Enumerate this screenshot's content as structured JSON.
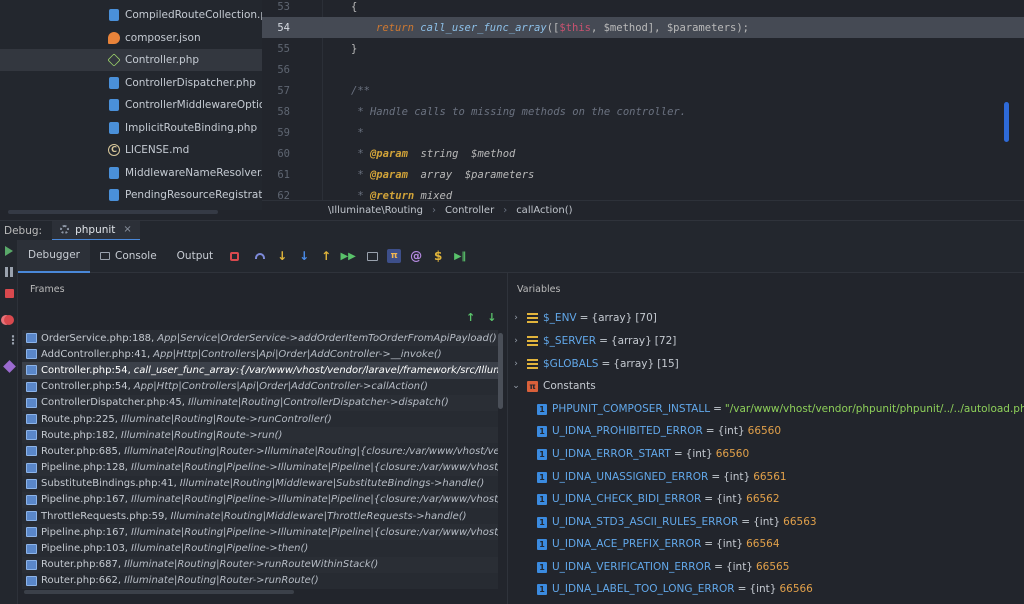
{
  "project_tree": {
    "items": [
      {
        "label": "CompiledRouteCollection.php",
        "icon": "php-file-icon"
      },
      {
        "label": "composer.json",
        "icon": "json-file-icon"
      },
      {
        "label": "Controller.php",
        "icon": "class-icon",
        "selected": true
      },
      {
        "label": "ControllerDispatcher.php",
        "icon": "php-file-icon"
      },
      {
        "label": "ControllerMiddlewareOptions",
        "icon": "php-file-icon"
      },
      {
        "label": "ImplicitRouteBinding.php",
        "icon": "php-file-icon"
      },
      {
        "label": "LICENSE.md",
        "icon": "license-icon"
      },
      {
        "label": "MiddlewareNameResolver.ph",
        "icon": "php-file-icon"
      },
      {
        "label": "PendingResourceRegistration",
        "icon": "php-file-icon"
      }
    ]
  },
  "editor": {
    "lines": [
      {
        "num": "53",
        "text": "{"
      },
      {
        "num": "54",
        "kw": "return ",
        "fn": "call_user_func_array",
        "open": "([",
        "this": "$this",
        "rest": ", $method], $parameters);"
      },
      {
        "num": "55",
        "text": "}"
      },
      {
        "num": "56",
        "text": ""
      },
      {
        "num": "57",
        "comment": "/**"
      },
      {
        "num": "58",
        "comment": " * Handle calls to missing methods on the controller."
      },
      {
        "num": "59",
        "comment": " *"
      },
      {
        "num": "60",
        "star": " * ",
        "tag": "@param",
        "type": "  string",
        "var": "  $method"
      },
      {
        "num": "61",
        "star": " * ",
        "tag": "@param",
        "type": "  array",
        "var": "  $parameters"
      },
      {
        "num": "62",
        "star": " * ",
        "tag": "@return",
        "type": " mixed",
        "var": ""
      }
    ],
    "breadcrumb": [
      "\\Illuminate\\Routing",
      "Controller",
      "callAction()"
    ]
  },
  "debug_bar": {
    "label": "Debug:",
    "tab": "phpunit",
    "close": "×"
  },
  "tabs": {
    "debugger": "Debugger",
    "console": "Console",
    "output": "Output"
  },
  "frames": {
    "title": "Frames",
    "up_arrow": "↑",
    "down_arrow": "↓",
    "rows": [
      {
        "file": "OrderService.php:188,",
        "desc": "App|Service|OrderService->addOrderItemToOrderFromApiPayload()"
      },
      {
        "file": "AddController.php:41,",
        "desc": "App|Http|Controllers|Api|Order|AddController->__invoke()"
      },
      {
        "file": "Controller.php:54,",
        "desc": "call_user_func_array:{/var/www/vhost/vendor/laravel/framework/src/Illuminate",
        "selected": true
      },
      {
        "file": "Controller.php:54,",
        "desc": "App|Http|Controllers|Api|Order|AddController->callAction()"
      },
      {
        "file": "ControllerDispatcher.php:45,",
        "desc": "Illuminate|Routing|ControllerDispatcher->dispatch()"
      },
      {
        "file": "Route.php:225,",
        "desc": "Illuminate|Routing|Route->runController()"
      },
      {
        "file": "Route.php:182,",
        "desc": "Illuminate|Routing|Route->run()"
      },
      {
        "file": "Router.php:685,",
        "desc": "Illuminate|Routing|Router->Illuminate|Routing|{closure:/var/www/vhost/vendor/"
      },
      {
        "file": "Pipeline.php:128,",
        "desc": "Illuminate|Routing|Pipeline->Illuminate|Pipeline|{closure:/var/www/vhost/vendo"
      },
      {
        "file": "SubstituteBindings.php:41,",
        "desc": "Illuminate|Routing|Middleware|SubstituteBindings->handle()"
      },
      {
        "file": "Pipeline.php:167,",
        "desc": "Illuminate|Routing|Pipeline->Illuminate|Pipeline|{closure:/var/www/vhost/vendo"
      },
      {
        "file": "ThrottleRequests.php:59,",
        "desc": "Illuminate|Routing|Middleware|ThrottleRequests->handle()"
      },
      {
        "file": "Pipeline.php:167,",
        "desc": "Illuminate|Routing|Pipeline->Illuminate|Pipeline|{closure:/var/www/vhost/vendo"
      },
      {
        "file": "Pipeline.php:103,",
        "desc": "Illuminate|Routing|Pipeline->then()"
      },
      {
        "file": "Router.php:687,",
        "desc": "Illuminate|Routing|Router->runRouteWithinStack()"
      },
      {
        "file": "Router.php:662,",
        "desc": "Illuminate|Routing|Router->runRoute()"
      }
    ]
  },
  "variables": {
    "title": "Variables",
    "groups": [
      {
        "name": "$_ENV",
        "type": "{array}",
        "count": "[70]"
      },
      {
        "name": "$_SERVER",
        "type": "{array}",
        "count": "[72]"
      },
      {
        "name": "$GLOBALS",
        "type": "{array}",
        "count": "[15]"
      }
    ],
    "constants_label": "Constants",
    "constants_icon_text": "π",
    "const_icon_text": "1",
    "constants": [
      {
        "name": "PHPUNIT_COMPOSER_INSTALL",
        "type": "",
        "value": "\"/var/www/vhost/vendor/phpunit/phpunit/../../autoload.php\"",
        "is_string": true
      },
      {
        "name": "U_IDNA_PROHIBITED_ERROR",
        "type": "{int}",
        "value": "66560"
      },
      {
        "name": "U_IDNA_ERROR_START",
        "type": "{int}",
        "value": "66560"
      },
      {
        "name": "U_IDNA_UNASSIGNED_ERROR",
        "type": "{int}",
        "value": "66561"
      },
      {
        "name": "U_IDNA_CHECK_BIDI_ERROR",
        "type": "{int}",
        "value": "66562"
      },
      {
        "name": "U_IDNA_STD3_ASCII_RULES_ERROR",
        "type": "{int}",
        "value": "66563"
      },
      {
        "name": "U_IDNA_ACE_PREFIX_ERROR",
        "type": "{int}",
        "value": "66564"
      },
      {
        "name": "U_IDNA_VERIFICATION_ERROR",
        "type": "{int}",
        "value": "66565"
      },
      {
        "name": "U_IDNA_LABEL_TOO_LONG_ERROR",
        "type": "{int}",
        "value": "66566"
      }
    ]
  },
  "colors": {
    "accent": "#4a88d9",
    "background": "#22252c",
    "highlight_line": "#454a54"
  }
}
